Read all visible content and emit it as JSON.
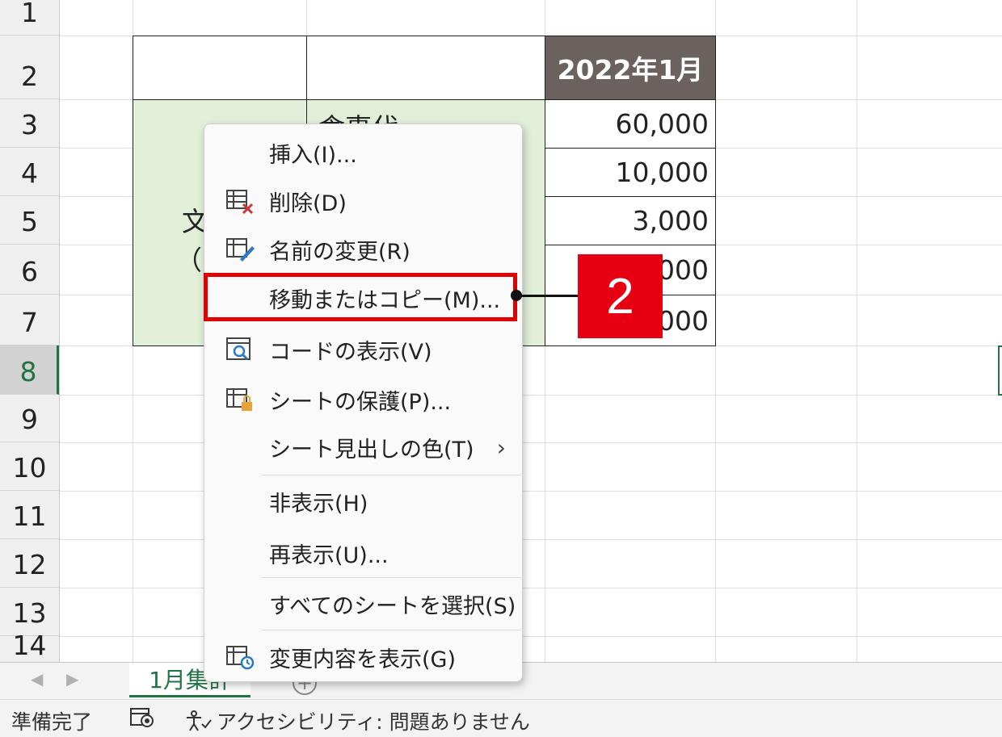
{
  "rows": [
    "1",
    "2",
    "3",
    "4",
    "5",
    "6",
    "7",
    "8",
    "9",
    "10",
    "11",
    "12",
    "13",
    "14"
  ],
  "table": {
    "header": "2022年1月",
    "label_c3": "食事代",
    "label_b5": "文",
    "label_b6": "（変",
    "values": [
      "60,000",
      "10,000",
      "3,000",
      "000",
      "000"
    ]
  },
  "context_menu": {
    "items": [
      {
        "label": "挿入(I)...",
        "icon": "none"
      },
      {
        "label": "削除(D)",
        "icon": "delete-sheet-icon"
      },
      {
        "label": "名前の変更(R)",
        "icon": "rename-sheet-icon"
      },
      {
        "label": "移動またはコピー(M)...",
        "icon": "none"
      },
      {
        "label": "コードの表示(V)",
        "icon": "view-code-icon"
      },
      {
        "label": "シートの保護(P)...",
        "icon": "protect-sheet-icon"
      },
      {
        "label": "シート見出しの色(T)",
        "icon": "none",
        "submenu": "›"
      },
      {
        "label": "非表示(H)",
        "icon": "none"
      },
      {
        "label": "再表示(U)...",
        "icon": "none"
      },
      {
        "label": "すべてのシートを選択(S)",
        "icon": "none"
      },
      {
        "label": "変更内容を表示(G)",
        "icon": "show-changes-icon"
      }
    ]
  },
  "callout": {
    "number": "2",
    "color": "#e60012"
  },
  "sheet_tabs": {
    "active": "1月集計",
    "prev": "◀",
    "next": "▶",
    "add": "+"
  },
  "status_bar": {
    "ready": "準備完了",
    "accessibility": "アクセシビリティ: 問題ありません"
  },
  "colors": {
    "accent": "#217346",
    "header_dark": "#6b6260",
    "label_fill": "#e2efd9",
    "highlight": "#e00000"
  }
}
